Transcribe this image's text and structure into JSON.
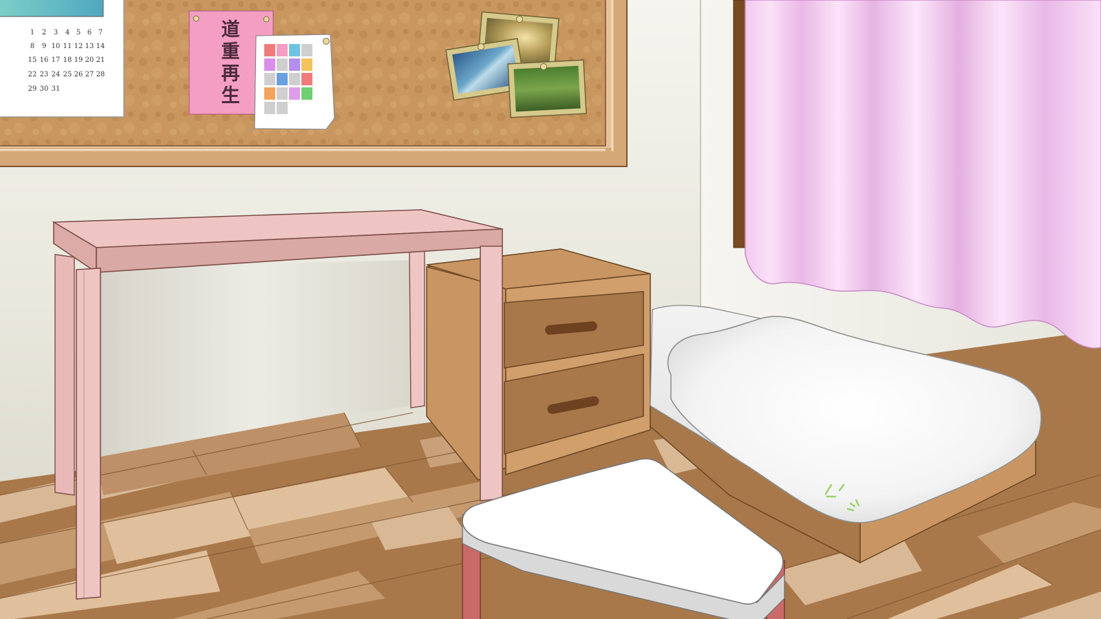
{
  "scene": {
    "name": "bedroom-background",
    "colors": {
      "wall": "#eeece2",
      "floor_dark": "#a8784a",
      "floor_light": "#d9b896",
      "corkboard": "#c8965e",
      "desk": "#eec5c2",
      "dresser": "#c99663",
      "curtain": "#f8d8f4",
      "bedding": "#f7f7f7",
      "stool_legs": "#c96a68"
    }
  },
  "calendar": {
    "weeks": [
      [
        "1",
        "2",
        "3",
        "4",
        "5",
        "6",
        "7"
      ],
      [
        "8",
        "9",
        "10",
        "11",
        "12",
        "13",
        "14"
      ],
      [
        "15",
        "16",
        "17",
        "18",
        "19",
        "20",
        "21"
      ],
      [
        "22",
        "23",
        "24",
        "25",
        "26",
        "27",
        "28"
      ],
      [
        "29",
        "30",
        "31"
      ]
    ]
  },
  "note": {
    "chars": [
      "道",
      "重",
      "再",
      "生"
    ]
  },
  "photos": [
    "ocean-photo",
    "sunset-photo",
    "forest-photo"
  ]
}
